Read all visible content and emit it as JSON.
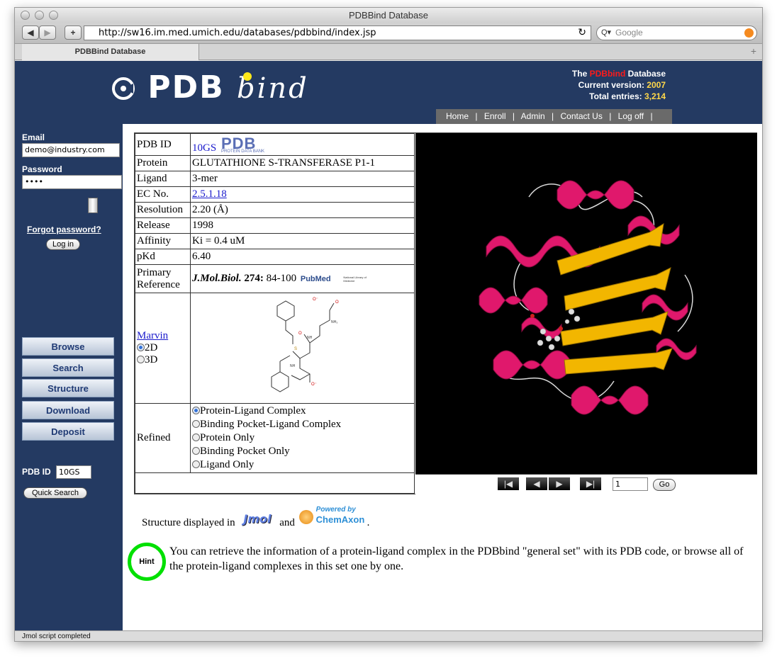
{
  "browser": {
    "window_title": "PDBBind Database",
    "url": "http://sw16.im.med.umich.edu/databases/pdbbind/index.jsp",
    "search_placeholder": "Google",
    "back_icon": "◀",
    "forward_icon": "▶",
    "add_icon": "+",
    "reload_icon": "↻",
    "search_icon": "Q▾",
    "tab_title": "PDBBind Database",
    "new_tab_icon": "+",
    "status": "Jmol script completed"
  },
  "header": {
    "logo_text": "PDB",
    "logo_script": "bind",
    "line1_prefix": "The",
    "line1_brand": "PDBbind",
    "line1_suffix": "Database",
    "version_label": "Current version:",
    "version_value": "2007",
    "entries_label": "Total entries:",
    "entries_value": "3,214",
    "brand_color": "#ff1a1a",
    "value_color": "#ffd84a"
  },
  "nav": {
    "items": [
      "Home",
      "Enroll",
      "Admin",
      "Contact Us",
      "Log off"
    ],
    "separator": "|"
  },
  "sidebar": {
    "email_label": "Email",
    "email_value": "demo@industry.com",
    "password_label": "Password",
    "password_value": "••••",
    "forgot_link": "Forgot password?",
    "login_button": "Log in",
    "nav_buttons": [
      "Browse",
      "Search",
      "Structure",
      "Download",
      "Deposit"
    ],
    "pdbid_label": "PDB ID",
    "pdbid_value": "10GS",
    "quick_search": "Quick Search"
  },
  "entry": {
    "pdb_id_label": "PDB ID",
    "pdb_id_value": "10GS",
    "pdb_logo": "PDB",
    "pdb_logo_sub": "PROTEIN DATA BANK",
    "protein_label": "Protein",
    "protein_value": "GLUTATHIONE S-TRANSFERASE P1-1",
    "ligand_label": "Ligand",
    "ligand_value": "3-mer",
    "ec_label": "EC No.",
    "ec_value": "2.5.1.18",
    "resolution_label": "Resolution",
    "resolution_value": "2.20 (Å)",
    "release_label": "Release",
    "release_value": "1998",
    "affinity_label": "Affinity",
    "affinity_value": "Ki  = 0.4 uM",
    "pkd_label": "pKd",
    "pkd_value": "6.40",
    "reference_label_1": "Primary",
    "reference_label_2": "Reference",
    "reference_journal": "J.Mol.Biol.",
    "reference_volume": "274:",
    "reference_pages": "84-100",
    "pubmed_logo": "PubMed",
    "nlm_logo": "National Library of Medicine",
    "marvin_link": "Marvin",
    "view_2d": "2D",
    "view_3d": "3D",
    "refined_label": "Refined",
    "refined_options": [
      "Protein-Ligand Complex",
      "Binding Pocket-Ligand Complex",
      "Protein Only",
      "Binding Pocket Only",
      "Ligand Only"
    ]
  },
  "viewer": {
    "frame_value": "1",
    "go_button": "Go",
    "first_icon": "|◀",
    "prev_icon": "◀",
    "next_icon": "▶",
    "last_icon": "▶|"
  },
  "footer": {
    "structure_text": "Structure displayed in",
    "jmol_logo": "Jmol",
    "and_text": "and",
    "chemaxon_powered": "Powered by",
    "chemaxon_logo": "ChemAxon",
    "period": ".",
    "hint_badge": "Hint",
    "hint_text": "You can retrieve the information of a protein-ligand complex in the PDBbind \"general set\" with its PDB code, or browse all of the protein-ligand complexes in this set one by one."
  }
}
